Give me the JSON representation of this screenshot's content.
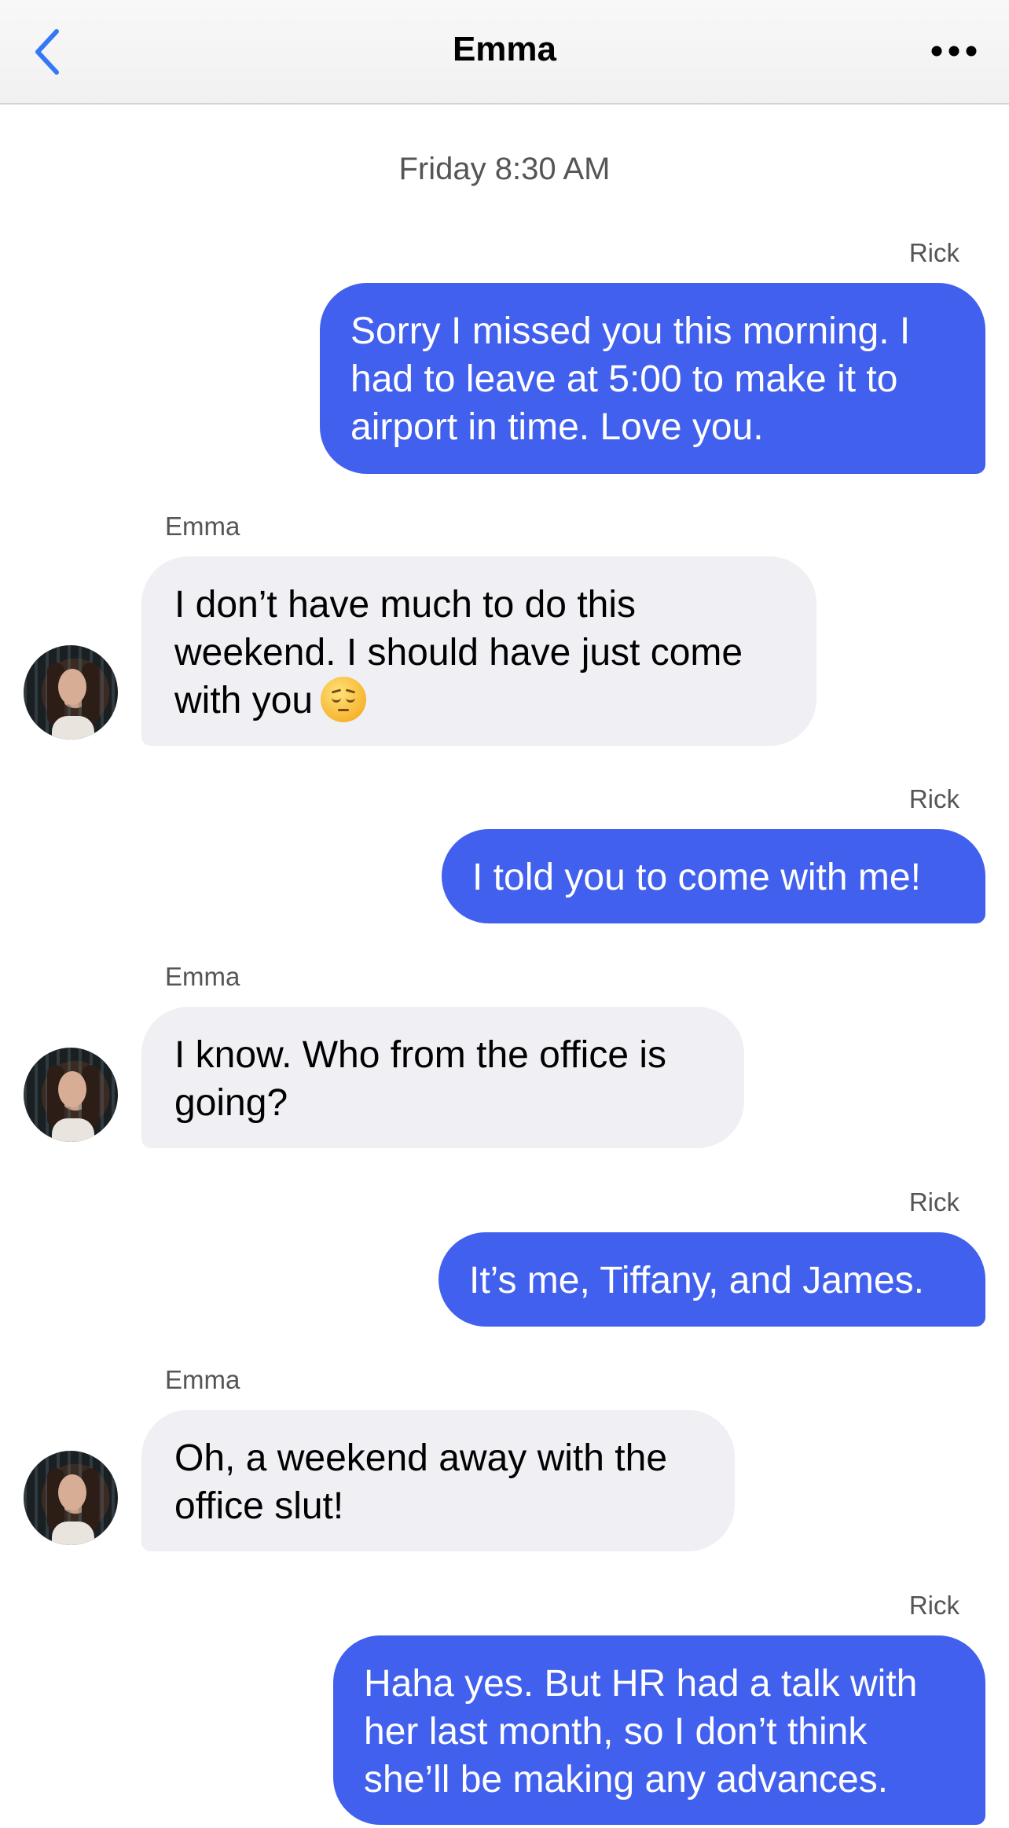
{
  "header": {
    "title": "Emma",
    "back_icon": "chevron-left-icon",
    "more_icon": "ellipsis-icon",
    "accent_color": "#3478f6"
  },
  "timestamp": "Friday 8:30 AM",
  "colors": {
    "outgoing_bubble": "#4260ee",
    "incoming_bubble": "#efeff4"
  },
  "messages": [
    {
      "sender": "Rick",
      "direction": "outgoing",
      "lines": [
        "Sorry I missed you this morning. I",
        "had to leave at 5:00 to make it to",
        "airport in time. Love you."
      ]
    },
    {
      "sender": "Emma",
      "direction": "incoming",
      "lines": [
        "I don’t have much to do this",
        "weekend. I should have just come",
        "with you"
      ],
      "emoji": "pensive-face-emoji"
    },
    {
      "sender": "Rick",
      "direction": "outgoing",
      "lines": [
        "I told you to come with me!"
      ]
    },
    {
      "sender": "Emma",
      "direction": "incoming",
      "lines": [
        "I know. Who from the office is",
        "going?"
      ]
    },
    {
      "sender": "Rick",
      "direction": "outgoing",
      "lines": [
        "It’s me, Tiffany, and James."
      ]
    },
    {
      "sender": "Emma",
      "direction": "incoming",
      "lines": [
        "Oh, a weekend away with the",
        "office slut!"
      ]
    },
    {
      "sender": "Rick",
      "direction": "outgoing",
      "lines": [
        "Haha yes. But HR had a talk with",
        "her last month, so I don’t think",
        "she’ll be making any advances."
      ]
    }
  ]
}
